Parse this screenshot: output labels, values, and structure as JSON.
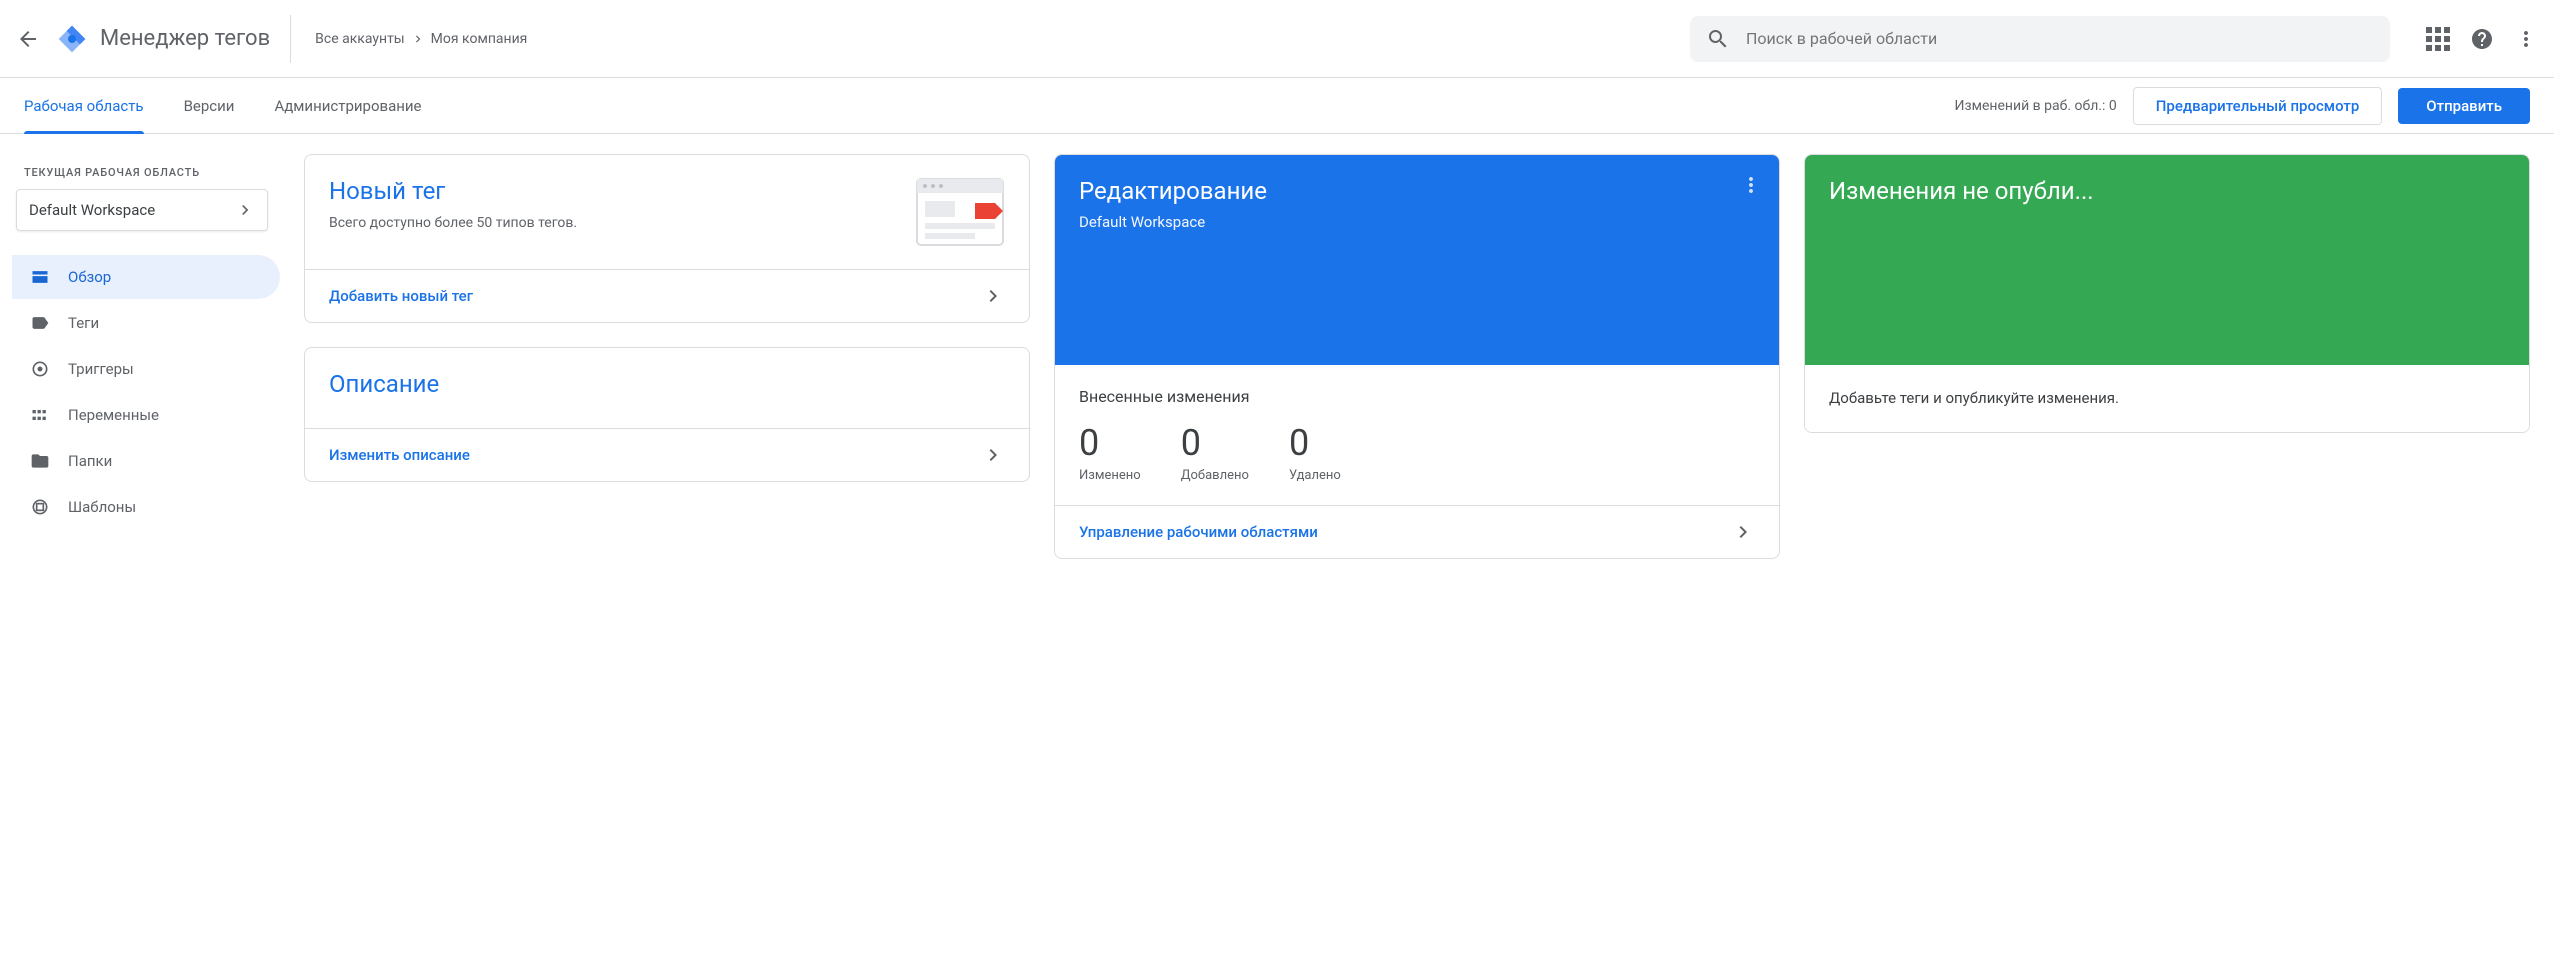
{
  "header": {
    "app_title": "Менеджер тегов",
    "breadcrumb_all_accounts": "Все аккаунты",
    "breadcrumb_company": "Моя компания",
    "search_placeholder": "Поиск в рабочей области"
  },
  "tabs": {
    "workspace": "Рабочая область",
    "versions": "Версии",
    "admin": "Администрирование",
    "changes_label": "Изменений в раб. обл.: 0",
    "preview": "Предварительный просмотр",
    "submit": "Отправить"
  },
  "sidebar": {
    "current_ws_label": "ТЕКУЩАЯ РАБОЧАЯ ОБЛАСТЬ",
    "ws_name": "Default Workspace",
    "items": [
      {
        "label": "Обзор"
      },
      {
        "label": "Теги"
      },
      {
        "label": "Триггеры"
      },
      {
        "label": "Переменные"
      },
      {
        "label": "Папки"
      },
      {
        "label": "Шаблоны"
      }
    ]
  },
  "cards": {
    "new_tag": {
      "title": "Новый тег",
      "subtitle": "Всего доступно более 50 типов тегов.",
      "action": "Добавить новый тег"
    },
    "description": {
      "title": "Описание",
      "action": "Изменить описание"
    },
    "editing": {
      "title": "Редактирование",
      "subtitle": "Default Workspace",
      "changes_title": "Внесенные изменения",
      "stats": [
        {
          "num": "0",
          "label": "Изменено"
        },
        {
          "num": "0",
          "label": "Добавлено"
        },
        {
          "num": "0",
          "label": "Удалено"
        }
      ],
      "action": "Управление рабочими областями"
    },
    "unpublished": {
      "title": "Изменения не опубли...",
      "body": "Добавьте теги и опубликуйте изменения."
    }
  }
}
